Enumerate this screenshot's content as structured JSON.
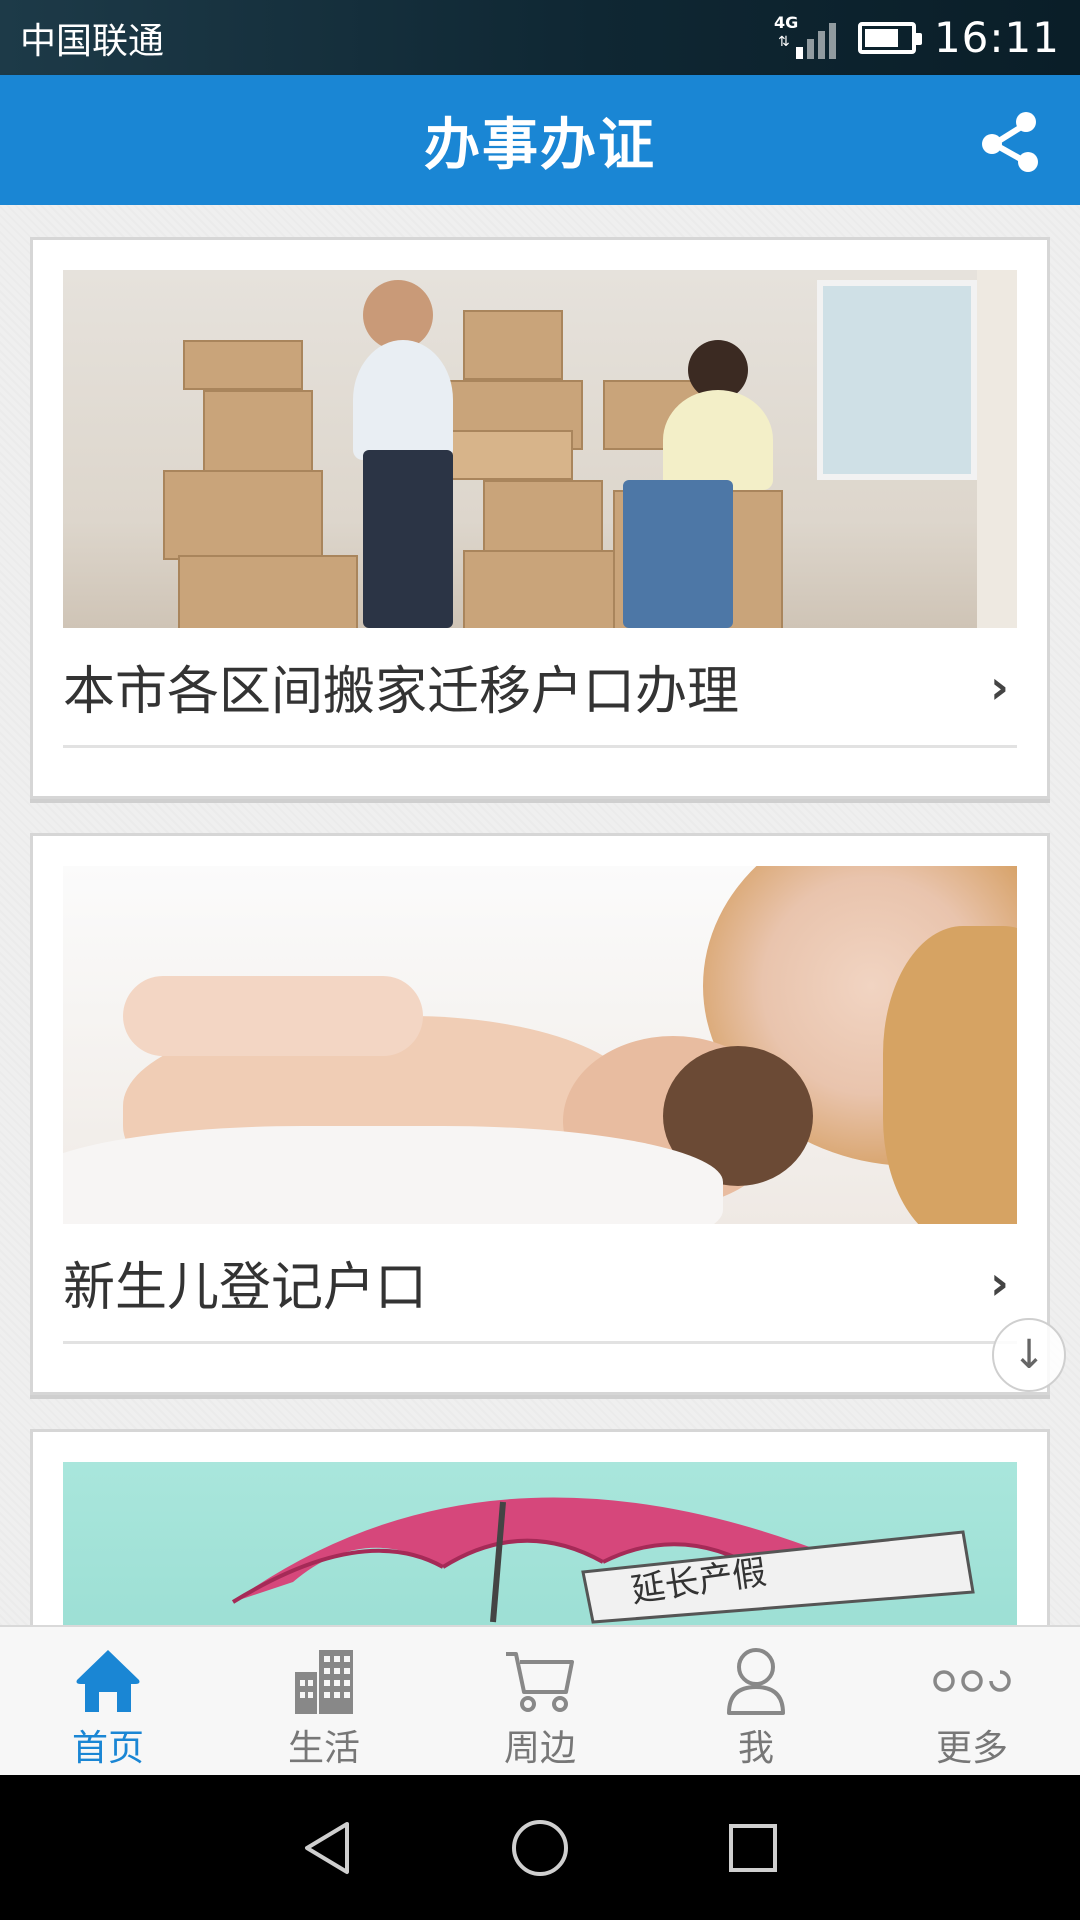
{
  "status_bar": {
    "carrier": "中国联通",
    "network": "4G",
    "time": "16:11",
    "battery_level": 0.75
  },
  "header": {
    "title": "办事办证",
    "share_icon": "share-icon"
  },
  "cards": [
    {
      "title": "本市各区间搬家迁移户口办理"
    },
    {
      "title": "新生儿登记户口"
    },
    {
      "image_caption": "延长产假"
    }
  ],
  "bottom_nav": {
    "items": [
      {
        "label": "首页",
        "icon": "home-icon",
        "active": true
      },
      {
        "label": "生活",
        "icon": "building-icon",
        "active": false
      },
      {
        "label": "周边",
        "icon": "cart-icon",
        "active": false
      },
      {
        "label": "我",
        "icon": "person-icon",
        "active": false
      },
      {
        "label": "更多",
        "icon": "more-icon",
        "active": false
      }
    ]
  },
  "colors": {
    "primary": "#1a86d4",
    "nav_inactive": "#777777"
  }
}
